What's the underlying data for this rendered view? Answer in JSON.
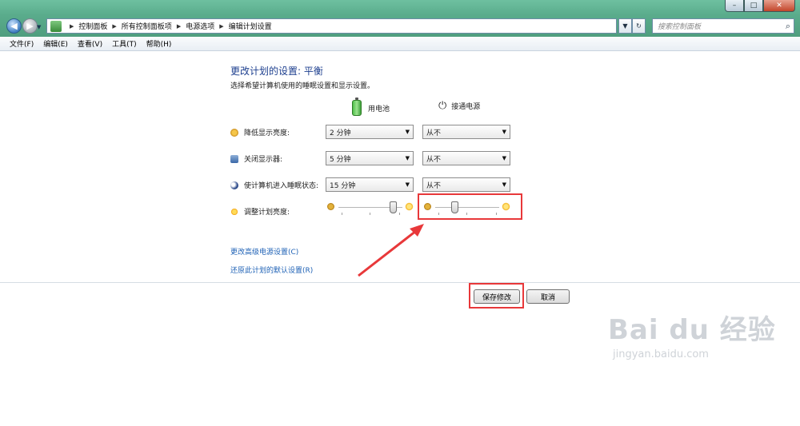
{
  "window": {
    "caption_buttons": [
      "–",
      "□",
      "✕"
    ],
    "breadcrumb": [
      "控制面板",
      "所有控制面板项",
      "电源选项",
      "编辑计划设置"
    ],
    "search_placeholder": "搜索控制面板",
    "refresh_symbol": "↻",
    "nav_back_symbol": "◀",
    "nav_forward_symbol": "▶"
  },
  "menu": [
    "文件(F)",
    "编辑(E)",
    "查看(V)",
    "工具(T)",
    "帮助(H)"
  ],
  "page": {
    "title": "更改计划的设置: 平衡",
    "subtitle": "选择希望计算机使用的睡眠设置和显示设置。",
    "col_battery": "用电池",
    "col_plugged": "接通电源",
    "rows": [
      {
        "label": "降低显示亮度:",
        "battery": "2 分钟",
        "plugged": "从不"
      },
      {
        "label": "关闭显示器:",
        "battery": "5 分钟",
        "plugged": "从不"
      },
      {
        "label": "使计算机进入睡眠状态:",
        "battery": "15 分钟",
        "plugged": "从不"
      }
    ],
    "brightness_label": "调整计划亮度:",
    "brightness_battery_level": 0.85,
    "brightness_plugged_level": 0.3,
    "link_advanced": "更改高级电源设置(C)",
    "link_restore": "还原此计划的默认设置(R)",
    "save_button": "保存修改",
    "cancel_button": "取消"
  },
  "watermark": {
    "brand": "Bai du 经验",
    "url": "jingyan.baidu.com"
  },
  "colors": {
    "title_blue": "#1d3f8f",
    "link_blue": "#1f62b6",
    "highlight_red": "#e8383a",
    "chrome_green": "#5aac8c"
  }
}
